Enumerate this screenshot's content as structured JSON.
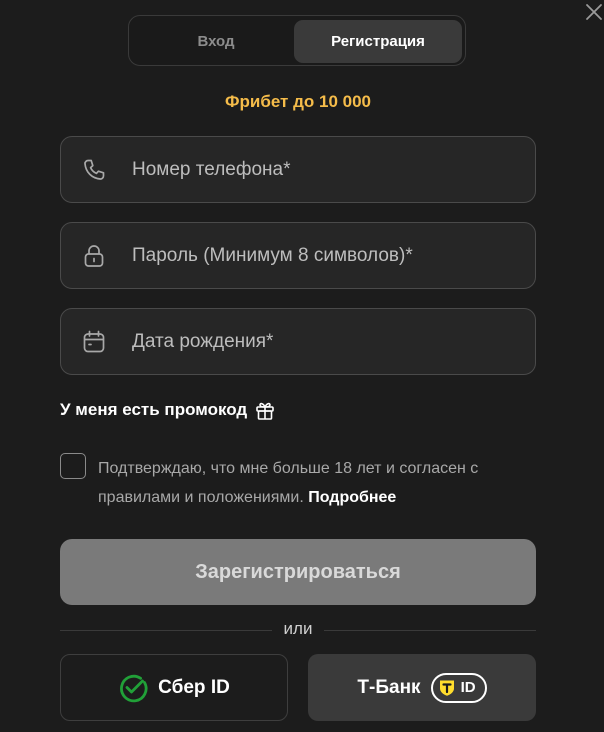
{
  "tabs": {
    "login": "Вход",
    "register": "Регистрация"
  },
  "promo_title": "Фрибет до 10 000",
  "fields": {
    "phone": {
      "placeholder": "Номер телефона*",
      "value": ""
    },
    "password": {
      "placeholder": "Пароль (Минимум 8 символов)*",
      "value": ""
    },
    "birthdate": {
      "placeholder": "Дата рождения*",
      "value": ""
    }
  },
  "promo_code_link": "У меня есть промокод",
  "consent": {
    "text": "Подтверждаю, что мне больше 18 лет и согласен с правилами и положениями.",
    "more_link": "Подробнее",
    "checked": false
  },
  "submit_label": "Зарегистрироваться",
  "divider_text": "или",
  "social": {
    "sber_label": "Сбер ID",
    "tbank_label": "Т-Банк",
    "tbank_badge": "ID"
  },
  "icons": {
    "close": "close-icon",
    "phone": "phone-icon",
    "lock": "lock-icon",
    "calendar": "calendar-icon",
    "gift": "gift-icon",
    "sber": "sber-logo-icon",
    "tbank": "tbank-logo-icon"
  },
  "colors": {
    "background": "#1c1c1c",
    "accent_promo": "#f5bc4a",
    "active_tab": "#3a3a3a",
    "field_bg": "#262626",
    "submit_disabled": "#7a7a7a",
    "sber_green": "#21a038",
    "tbank_yellow": "#ffdd2d"
  }
}
